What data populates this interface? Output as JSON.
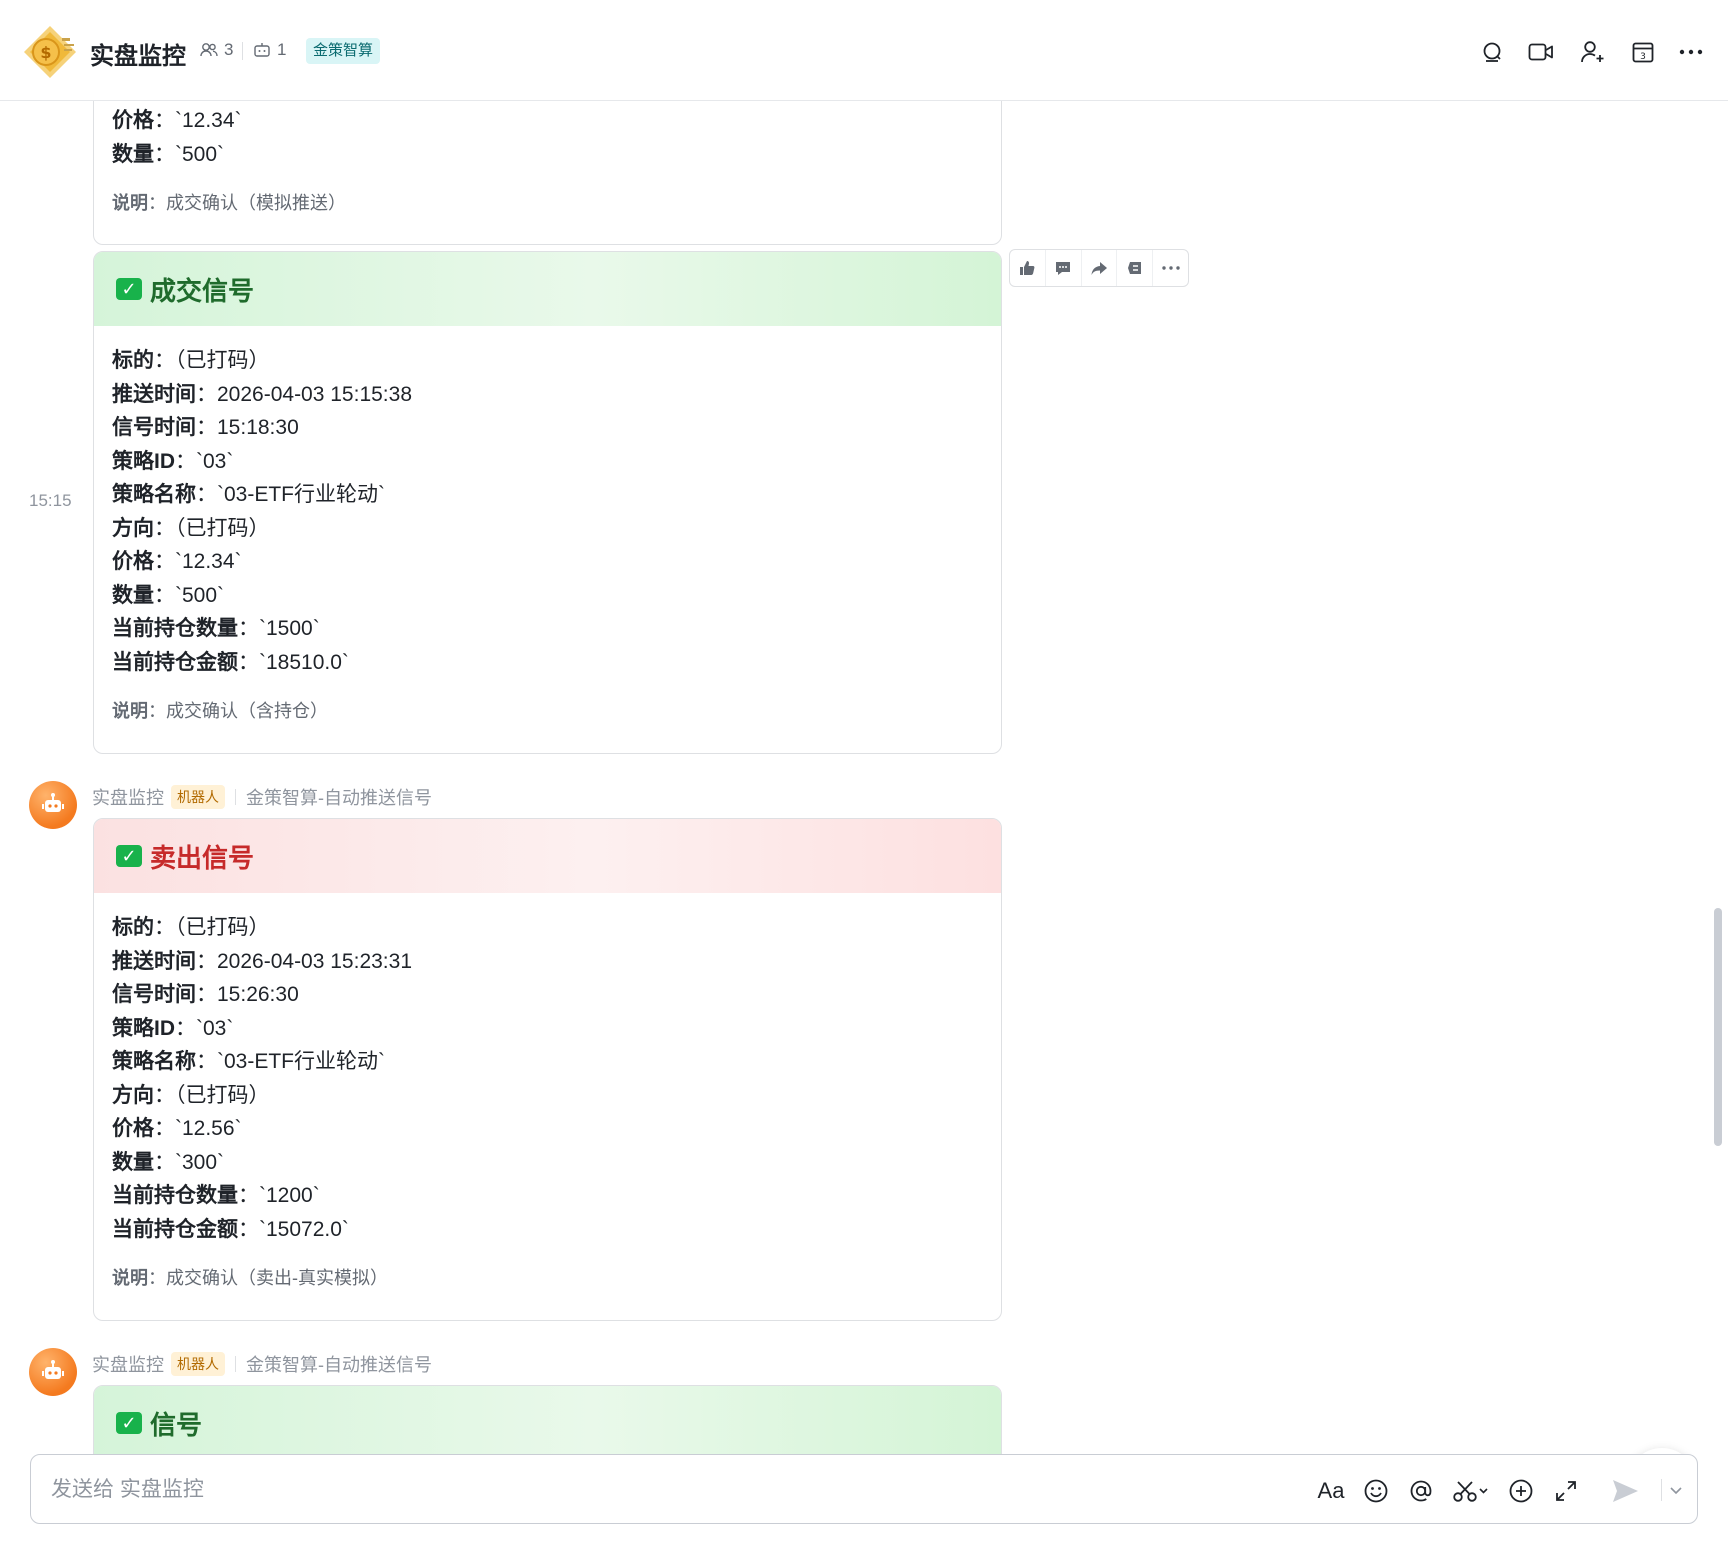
{
  "header": {
    "title": "实盘监控",
    "member_count": "3",
    "bot_count": "1",
    "tag": "金策智算",
    "icons": [
      "search-icon",
      "video-call-icon",
      "add-member-icon",
      "calendar-icon",
      "more-icon"
    ],
    "calendar_day": "3"
  },
  "messages": [
    {
      "price": "`12.34`",
      "quantity": "`500`",
      "note": "成交确认（模拟推送）"
    },
    {
      "time": "15:15",
      "header_color": "#d5f4d9",
      "header": "成交信号",
      "target": "（已打码）",
      "push_time": "2026-04-03 15:15:38",
      "signal_time": "15:18:30",
      "strategy_id": "`03`",
      "strategy_name": "`03-ETF行业轮动`",
      "direction": "（已打码）",
      "price": "`12.34`",
      "quantity": "`500`",
      "position_qty": "`1500`",
      "position_amount": "`18510.0`",
      "note": "成交确认（含持仓）"
    },
    {
      "sender": "实盘监控",
      "sender_badge": "机器人",
      "sender_group": "金策智算-自动推送信号",
      "header_color": "#fbe1e1",
      "header": "卖出信号",
      "target": "（已打码）",
      "push_time": "2026-04-03 15:23:31",
      "signal_time": "15:26:30",
      "strategy_id": "`03`",
      "strategy_name": "`03-ETF行业轮动`",
      "direction": "（已打码）",
      "price": "`12.56`",
      "quantity": "`300`",
      "position_qty": "`1200`",
      "position_amount": "`15072.0`",
      "note": "成交确认（卖出-真实模拟）"
    },
    {
      "sender": "实盘监控",
      "sender_badge": "机器人",
      "sender_group": "金策智算-自动推送信号",
      "header_color": "#d5f4d9",
      "header": "信号"
    }
  ],
  "labels": {
    "target": "标的",
    "push_time": "推送时间",
    "signal_time": "信号时间",
    "strategy_id": "策略ID",
    "strategy_name": "策略名称",
    "direction": "方向",
    "price": "价格",
    "quantity": "数量",
    "position_qty": "当前持仓数量",
    "position_amount": "当前持仓金额",
    "note": "说明",
    "colon": "："
  },
  "hover_toolbar": [
    "thumbs-up-icon",
    "reply-icon",
    "forward-icon",
    "pin-icon",
    "more-icon"
  ],
  "composer": {
    "placeholder": "发送给 实盘监控",
    "font_label": "Aa",
    "icons": [
      "emoji-icon",
      "mention-icon",
      "scissors-icon",
      "plus-circle-icon",
      "expand-icon",
      "send-icon",
      "chevron-down-icon"
    ]
  }
}
